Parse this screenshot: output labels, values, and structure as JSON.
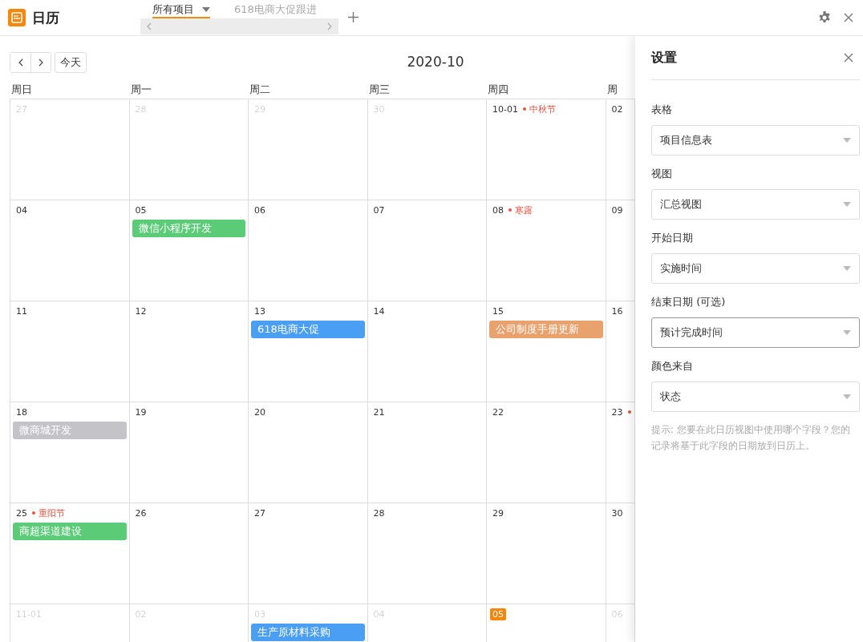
{
  "app": {
    "title": "日历"
  },
  "tabs": [
    {
      "label": "所有项目",
      "selected": true,
      "dropdown": true
    },
    {
      "label": "618电商大促跟进",
      "selected": false,
      "dropdown": false
    }
  ],
  "calendar": {
    "title": "2020-10",
    "today_button": "今天",
    "weekdays": [
      "周日",
      "周一",
      "周二",
      "周三",
      "周四",
      "周"
    ],
    "weeks": [
      [
        {
          "date": "27",
          "other_month": true
        },
        {
          "date": "28",
          "other_month": true
        },
        {
          "date": "29",
          "other_month": true
        },
        {
          "date": "30",
          "other_month": true
        },
        {
          "date": "10-01",
          "other_month": false,
          "holiday": "中秋节"
        },
        {
          "date": "02",
          "other_month": false
        }
      ],
      [
        {
          "date": "04",
          "other_month": false
        },
        {
          "date": "05",
          "other_month": false,
          "events": [
            {
              "title": "微信小程序开发",
              "color": "#5ccb78"
            }
          ]
        },
        {
          "date": "06",
          "other_month": false
        },
        {
          "date": "07",
          "other_month": false
        },
        {
          "date": "08",
          "other_month": false,
          "holiday": "寒露"
        },
        {
          "date": "09",
          "other_month": false
        }
      ],
      [
        {
          "date": "11",
          "other_month": false
        },
        {
          "date": "12",
          "other_month": false
        },
        {
          "date": "13",
          "other_month": false,
          "events": [
            {
              "title": "618电商大促",
              "color": "#4a9ff5"
            }
          ]
        },
        {
          "date": "14",
          "other_month": false
        },
        {
          "date": "15",
          "other_month": false,
          "events": [
            {
              "title": "公司制度手册更新",
              "color": "#e9a26d"
            }
          ]
        },
        {
          "date": "16",
          "other_month": false
        }
      ],
      [
        {
          "date": "18",
          "other_month": false,
          "events": [
            {
              "title": "微商城开发",
              "color": "#c4c3c8"
            }
          ]
        },
        {
          "date": "19",
          "other_month": false
        },
        {
          "date": "20",
          "other_month": false
        },
        {
          "date": "21",
          "other_month": false
        },
        {
          "date": "22",
          "other_month": false
        },
        {
          "date": "23",
          "other_month": false,
          "holiday_dot": true
        }
      ],
      [
        {
          "date": "25",
          "other_month": false,
          "holiday": "重阳节",
          "events": [
            {
              "title": "商超渠道建设",
              "color": "#5ccb78"
            }
          ]
        },
        {
          "date": "26",
          "other_month": false
        },
        {
          "date": "27",
          "other_month": false
        },
        {
          "date": "28",
          "other_month": false
        },
        {
          "date": "29",
          "other_month": false
        },
        {
          "date": "30",
          "other_month": false
        }
      ],
      [
        {
          "date": "11-01",
          "other_month": true
        },
        {
          "date": "02",
          "other_month": true
        },
        {
          "date": "03",
          "other_month": true,
          "events": [
            {
              "title": "生产原材料采购",
              "color": "#4a9ff5"
            }
          ]
        },
        {
          "date": "04",
          "other_month": true
        },
        {
          "date": "05",
          "today": true
        },
        {
          "date": "06",
          "other_month": true
        }
      ]
    ]
  },
  "settings": {
    "title": "设置",
    "fields": [
      {
        "label": "表格",
        "value": "项目信息表",
        "focused": false
      },
      {
        "label": "视图",
        "value": "汇总视图",
        "focused": false
      },
      {
        "label": "开始日期",
        "value": "实施时间",
        "focused": false
      },
      {
        "label": "结束日期 (可选)",
        "value": "预计完成时间",
        "focused": true
      },
      {
        "label": "颜色来自",
        "value": "状态",
        "focused": false
      }
    ],
    "hint": "提示: 您要在此日历视图中使用哪个字段？您的记录将基于此字段的日期放到日历上。"
  }
}
